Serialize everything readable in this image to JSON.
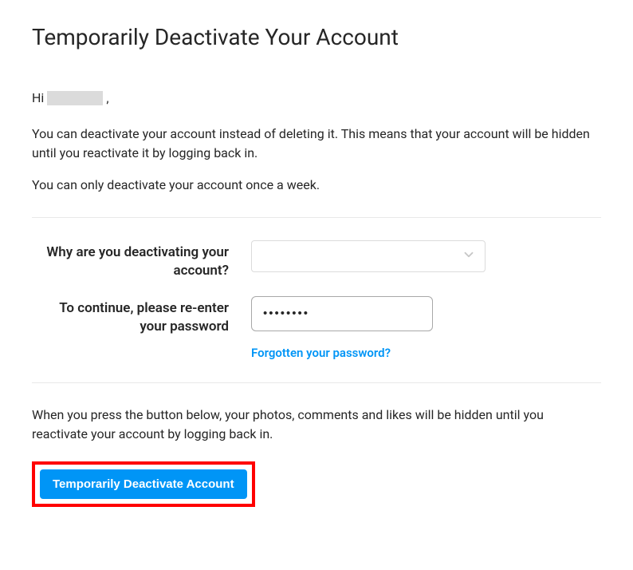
{
  "header": {
    "title": "Temporarily Deactivate Your Account"
  },
  "greeting": {
    "prefix": "Hi ",
    "suffix": ","
  },
  "intro": {
    "p1": "You can deactivate your account instead of deleting it. This means that your account will be hidden until you reactivate it by logging back in.",
    "p2": "You can only deactivate your account once a week."
  },
  "form": {
    "reason_label": "Why are you deactivating your account?",
    "reason_value": "",
    "password_label": "To continue, please re-enter your password",
    "password_value": "••••••••",
    "forgot_link": "Forgotten your password?"
  },
  "footer": {
    "note": "When you press the button below, your photos, comments and likes will be hidden until you reactivate your account by logging back in.",
    "button_label": "Temporarily Deactivate Account"
  },
  "colors": {
    "accent": "#0095f6",
    "highlight_border": "#ff0000"
  }
}
